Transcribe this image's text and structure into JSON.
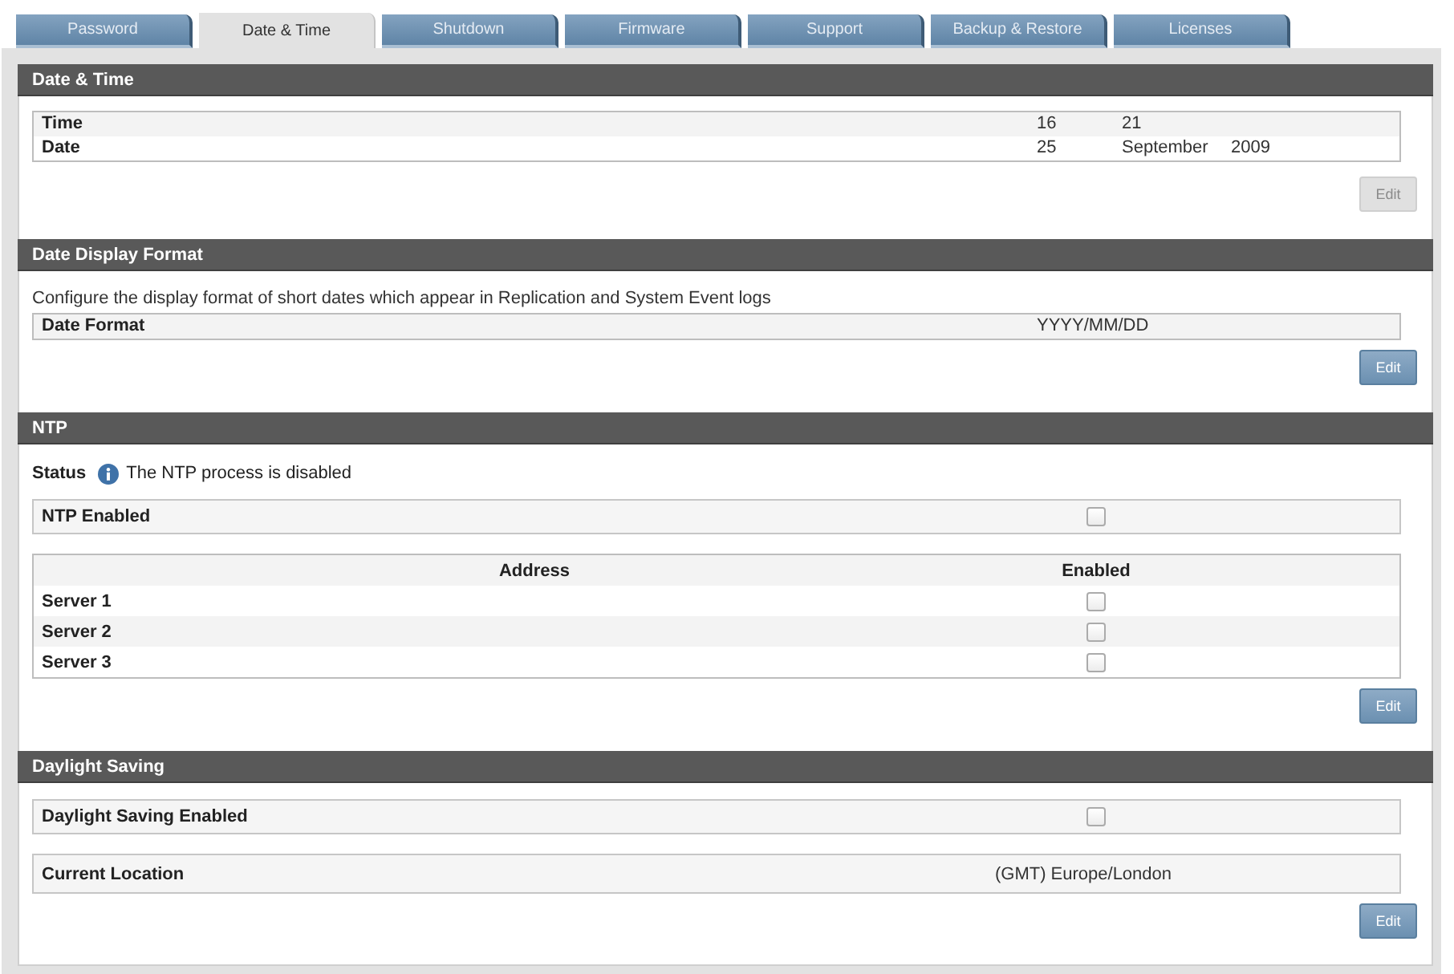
{
  "tabs": [
    {
      "label": "Password",
      "selected": false
    },
    {
      "label": "Date & Time",
      "selected": true
    },
    {
      "label": "Shutdown",
      "selected": false
    },
    {
      "label": "Firmware",
      "selected": false
    },
    {
      "label": "Support",
      "selected": false
    },
    {
      "label": "Backup & Restore",
      "selected": false
    },
    {
      "label": "Licenses",
      "selected": false
    }
  ],
  "sections": [
    {
      "title": "Date & Time",
      "blocks": [
        {
          "kind": "kv-table",
          "rows": [
            {
              "label": "Time",
              "values": [
                "16",
                "21"
              ]
            },
            {
              "label": "Date",
              "values": [
                "25",
                "September",
                "2009"
              ]
            }
          ]
        }
      ],
      "edit_button": {
        "label": "Edit",
        "disabled": true
      }
    },
    {
      "title": "Date Display Format",
      "blocks": [
        {
          "kind": "text",
          "text": "Configure the display format of short dates which appear in Replication and System Event logs"
        },
        {
          "kind": "kv-table",
          "rows": [
            {
              "label": "Date Format",
              "values": [
                "YYYY/MM/DD"
              ]
            }
          ]
        }
      ],
      "edit_button": {
        "label": "Edit",
        "disabled": false
      }
    },
    {
      "title": "NTP",
      "blocks": [
        {
          "kind": "status",
          "label": "Status",
          "text": "The NTP process is disabled"
        },
        {
          "kind": "check-row",
          "label": "NTP Enabled",
          "checked": false
        },
        {
          "kind": "server-table",
          "columns": [
            "Address",
            "Enabled"
          ],
          "rows": [
            {
              "label": "Server 1",
              "checked": false
            },
            {
              "label": "Server 2",
              "checked": false
            },
            {
              "label": "Server 3",
              "checked": false
            }
          ]
        }
      ],
      "edit_button": {
        "label": "Edit",
        "disabled": false
      }
    },
    {
      "title": "Daylight Saving",
      "blocks": [
        {
          "kind": "check-row",
          "label": "Daylight Saving Enabled",
          "checked": false
        },
        {
          "kind": "kv-row",
          "label": "Current Location",
          "value": "(GMT) Europe/London"
        }
      ],
      "edit_button": {
        "label": "Edit",
        "disabled": false
      }
    }
  ]
}
